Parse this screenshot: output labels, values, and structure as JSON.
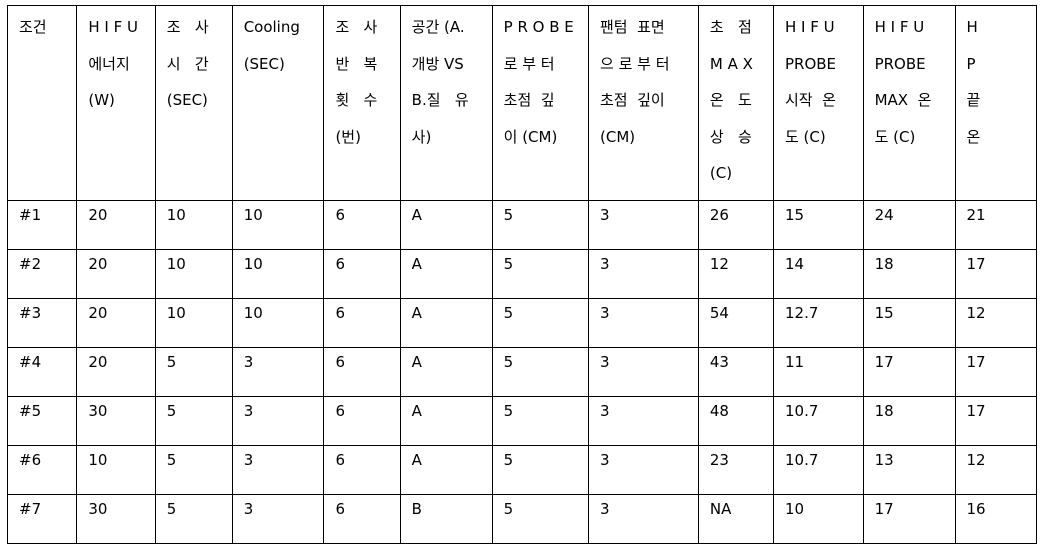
{
  "table": {
    "header": [
      {
        "lines": [
          "조건"
        ]
      },
      {
        "lines": [
          "H I F U",
          "에너지",
          "(W)"
        ]
      },
      {
        "lines": [
          "조   사",
          "시   간",
          "(SEC)"
        ]
      },
      {
        "lines": [
          "Cooling",
          "(SEC)"
        ]
      },
      {
        "lines": [
          "조   사",
          "반   복",
          "횟   수",
          "(번)"
        ]
      },
      {
        "lines": [
          "공간 (A.",
          "개방 VS",
          "B.질   유",
          "사)"
        ]
      },
      {
        "lines": [
          "P R O B E",
          "로 부 터",
          "초점  깊",
          "이 (CM)"
        ]
      },
      {
        "lines": [
          "팬텀  표면",
          "으 로 부 터",
          "초점  깊이",
          "(CM)"
        ]
      },
      {
        "lines": [
          "초   점",
          "M A X",
          "온   도",
          "상   승",
          "(C)"
        ]
      },
      {
        "lines": [
          "H I F U",
          "PROBE",
          "시작  온",
          "도 (C)"
        ]
      },
      {
        "lines": [
          "H I F U",
          "PROBE",
          "MAX  온",
          "도 (C)"
        ]
      },
      {
        "lines": [
          "H",
          "P",
          "끝",
          "온"
        ]
      }
    ],
    "rows": [
      [
        "#1",
        "20",
        "10",
        "10",
        "6",
        "A",
        "5",
        "3",
        "26",
        "15",
        "24",
        "21"
      ],
      [
        "#2",
        "20",
        "10",
        "10",
        "6",
        "A",
        "5",
        "3",
        "12",
        "14",
        "18",
        "17"
      ],
      [
        "#3",
        "20",
        "10",
        "10",
        "6",
        "A",
        "5",
        "3",
        "54",
        "12.7",
        "15",
        "12"
      ],
      [
        "#4",
        "20",
        "5",
        "3",
        "6",
        "A",
        "5",
        "3",
        "43",
        "11",
        "17",
        "17"
      ],
      [
        "#5",
        "30",
        "5",
        "3",
        "6",
        "A",
        "5",
        "3",
        "48",
        "10.7",
        "18",
        "17"
      ],
      [
        "#6",
        "10",
        "5",
        "3",
        "6",
        "A",
        "5",
        "3",
        "23",
        "10.7",
        "13",
        "12"
      ],
      [
        "#7",
        "30",
        "5",
        "3",
        "6",
        "B",
        "5",
        "3",
        "NA",
        "10",
        "17",
        "16"
      ]
    ]
  }
}
